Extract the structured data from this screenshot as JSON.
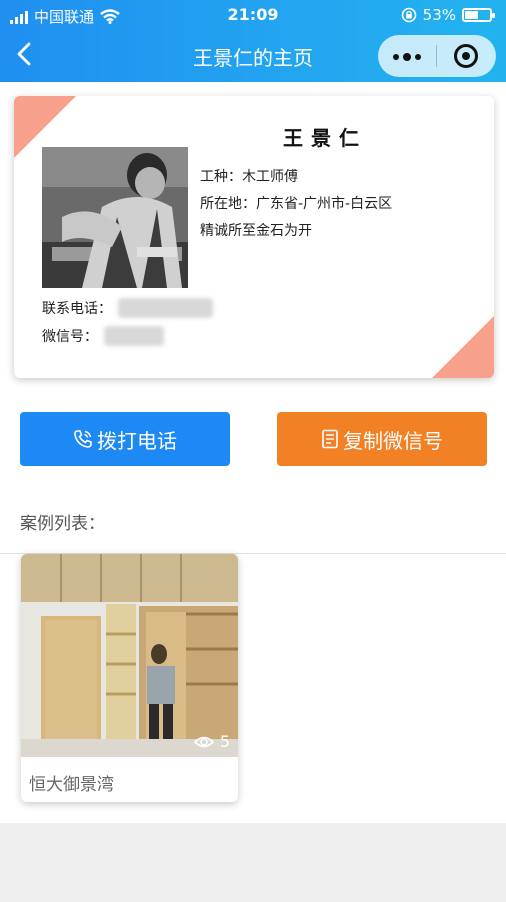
{
  "status_bar": {
    "carrier": "中国联通",
    "time": "21:09",
    "battery": "53%",
    "battery_level": 0.53
  },
  "nav": {
    "back_icon": "chevron-left-icon",
    "title": "王景仁的主页",
    "more_icon": "more-dots-icon",
    "close_icon": "target-icon"
  },
  "profile": {
    "name": "王景仁",
    "trade": "工种：木工师傅",
    "location": "所在地：广东省-广州市-白云区",
    "motto": "精诚所至金石为开",
    "phone_label": "联系电话：",
    "wechat_label": "微信号：",
    "accent_color": "#f7a08c"
  },
  "actions": {
    "call_label": "拨打电话",
    "call_icon": "phone-icon",
    "call_color": "#1c89f5",
    "copy_label": "复制微信号",
    "copy_icon": "document-icon",
    "copy_color": "#f28024"
  },
  "cases": {
    "title": "案例列表：",
    "items": [
      {
        "name": "恒大御景湾",
        "views": "5",
        "views_icon": "eye-icon"
      }
    ]
  }
}
